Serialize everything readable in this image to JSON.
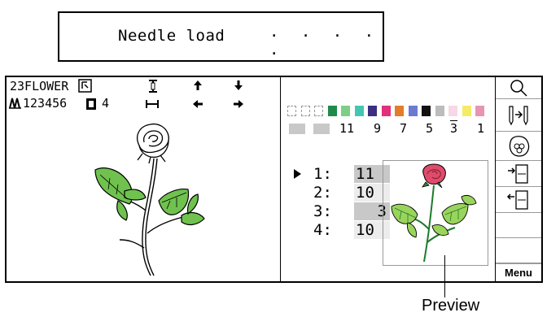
{
  "caption": {
    "text": "Needle load",
    "dots": "· · · · ·"
  },
  "pattern": {
    "name": "23FLOWER",
    "id": "123456",
    "count": "4"
  },
  "colors": {
    "swatches": [
      "empty",
      "empty",
      "empty",
      "#1f8a4a",
      "#7ccf84",
      "#44c7b2",
      "#3a2f80",
      "#e0317a",
      "#e37d2a",
      "#6a7bd0",
      "#111111",
      "#bcbcbc",
      "#f6d8e6",
      "#f4ec66",
      "#e695b4"
    ],
    "numbers": [
      "11",
      "9",
      "7",
      "5",
      "3",
      "1"
    ]
  },
  "needles": [
    {
      "label": "1:",
      "value": "11",
      "style": "dark",
      "selected": true
    },
    {
      "label": "2:",
      "value": "10",
      "style": "light",
      "selected": false
    },
    {
      "label": "3:",
      "value": "3",
      "style": "dark",
      "selected": false
    },
    {
      "label": "4:",
      "value": "10",
      "style": "light",
      "selected": false
    }
  ],
  "sidebar": {
    "buttons": [
      {
        "name": "zoom-button",
        "icon": "magnifier-icon"
      },
      {
        "name": "needle-move-button",
        "icon": "needle-arrow-icon"
      },
      {
        "name": "thread-button",
        "icon": "spool-icon"
      },
      {
        "name": "save-button",
        "icon": "file-in-icon"
      },
      {
        "name": "load-button",
        "icon": "file-out-icon"
      },
      {
        "name": "blank-button-1",
        "icon": ""
      },
      {
        "name": "blank-button-2",
        "icon": ""
      }
    ],
    "menu_label": "Menu"
  },
  "preview_label": "Preview"
}
